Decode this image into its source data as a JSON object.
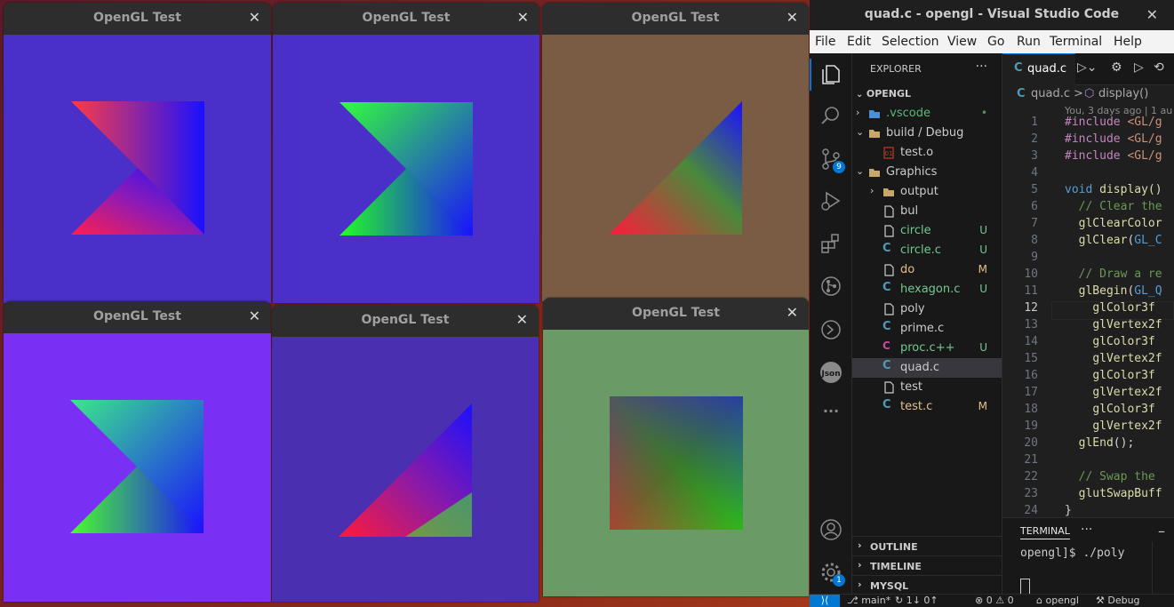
{
  "gl_windows": [
    {
      "title": "OpenGL Test",
      "close": "✕",
      "bg": "#4a2fc9"
    },
    {
      "title": "OpenGL Test",
      "close": "✕",
      "bg": "#4a2fc9"
    },
    {
      "title": "OpenGL Test",
      "close": "✕",
      "bg": "#7a5c45"
    },
    {
      "title": "OpenGL Test",
      "close": "✕",
      "bg": "#7a2ff5"
    },
    {
      "title": "OpenGL Test",
      "close": "✕",
      "bg": "#4a2fb0"
    },
    {
      "title": "OpenGL Test",
      "close": "✕",
      "bg": "#6a9a66"
    }
  ],
  "vscode": {
    "title": "quad.c - opengl - Visual Studio Code",
    "close": "✕",
    "menu": [
      "File",
      "Edit",
      "Selection",
      "View",
      "Go",
      "Run",
      "Terminal",
      "Help"
    ],
    "explorer_label": "EXPLORER",
    "explorer_more": "···",
    "root": "OPENGL",
    "tree": [
      {
        "name": ".vscode",
        "kind": "folder-vscode",
        "status": "•",
        "status_color": "#4d9c5a",
        "name_color": "#58b87b"
      },
      {
        "name": "build / Debug",
        "kind": "folder-open",
        "status": "",
        "status_color": "",
        "name_color": "#cccccc"
      },
      {
        "name": "test.o",
        "kind": "binary",
        "status": "",
        "status_color": "",
        "name_color": "#cccccc"
      },
      {
        "name": "Graphics",
        "kind": "folder-open",
        "status": "",
        "status_color": "",
        "name_color": "#cccccc"
      },
      {
        "name": "output",
        "kind": "folder",
        "status": "",
        "status_color": "",
        "name_color": "#cccccc"
      },
      {
        "name": "bul",
        "kind": "file",
        "status": "",
        "status_color": "",
        "name_color": "#cccccc"
      },
      {
        "name": "circle",
        "kind": "file",
        "status": "U",
        "status_color": "#73c991",
        "name_color": "#73c991"
      },
      {
        "name": "circle.c",
        "kind": "c",
        "status": "U",
        "status_color": "#73c991",
        "name_color": "#73c991"
      },
      {
        "name": "do",
        "kind": "file",
        "status": "M",
        "status_color": "#e2c08d",
        "name_color": "#e2c08d"
      },
      {
        "name": "hexagon.c",
        "kind": "c",
        "status": "U",
        "status_color": "#73c991",
        "name_color": "#73c991"
      },
      {
        "name": "poly",
        "kind": "file",
        "status": "",
        "status_color": "",
        "name_color": "#cccccc"
      },
      {
        "name": "prime.c",
        "kind": "c",
        "status": "",
        "status_color": "",
        "name_color": "#cccccc"
      },
      {
        "name": "proc.c++",
        "kind": "cpp",
        "status": "U",
        "status_color": "#73c991",
        "name_color": "#73c991"
      },
      {
        "name": "quad.c",
        "kind": "c",
        "status": "",
        "status_color": "",
        "name_color": "#cccccc"
      },
      {
        "name": "test",
        "kind": "file",
        "status": "",
        "status_color": "",
        "name_color": "#cccccc"
      },
      {
        "name": "test.c",
        "kind": "c",
        "status": "M",
        "status_color": "#e2c08d",
        "name_color": "#e2c08d"
      }
    ],
    "panels": [
      "OUTLINE",
      "TIMELINE",
      "MYSQL"
    ],
    "tab": {
      "icon": "C",
      "name": "quad.c"
    },
    "breadcrumb": {
      "file": "quad.c",
      "sep": ">",
      "symbol": "display()"
    },
    "blame": "You, 3 days ago | 1 au",
    "code": [
      {
        "n": "1",
        "t": "#include <GL/g"
      },
      {
        "n": "2",
        "t": "#include <GL/g"
      },
      {
        "n": "3",
        "t": "#include <GL/g"
      },
      {
        "n": "4",
        "t": ""
      },
      {
        "n": "5",
        "t": "void display()"
      },
      {
        "n": "6",
        "t": "  // Clear the"
      },
      {
        "n": "7",
        "t": "  glClearColor"
      },
      {
        "n": "8",
        "t": "  glClear(GL_C"
      },
      {
        "n": "9",
        "t": ""
      },
      {
        "n": "10",
        "t": "  // Draw a re"
      },
      {
        "n": "11",
        "t": "  glBegin(GL_Q"
      },
      {
        "n": "12",
        "t": "    glColor3f"
      },
      {
        "n": "13",
        "t": "    glVertex2f"
      },
      {
        "n": "14",
        "t": "    glColor3f"
      },
      {
        "n": "15",
        "t": "    glVertex2f"
      },
      {
        "n": "16",
        "t": "    glColor3f"
      },
      {
        "n": "17",
        "t": "    glVertex2f"
      },
      {
        "n": "18",
        "t": "    glColor3f"
      },
      {
        "n": "19",
        "t": "    glVertex2f"
      },
      {
        "n": "20",
        "t": "  glEnd();"
      },
      {
        "n": "21",
        "t": ""
      },
      {
        "n": "22",
        "t": "  // Swap the"
      },
      {
        "n": "23",
        "t": "  glutSwapBuff"
      },
      {
        "n": "24",
        "t": "}"
      }
    ],
    "terminal_label": "TERMINAL",
    "terminal_more": "···",
    "terminal_line": "opengl]$ ./poly",
    "scm_badge": "9",
    "settings_badge": "1",
    "status": {
      "branch": "main*",
      "sync": "↻ 1↓ 0↑",
      "problems": "⊗ 0 ⚠ 0",
      "folder": "opengl",
      "build": "Debug"
    }
  }
}
